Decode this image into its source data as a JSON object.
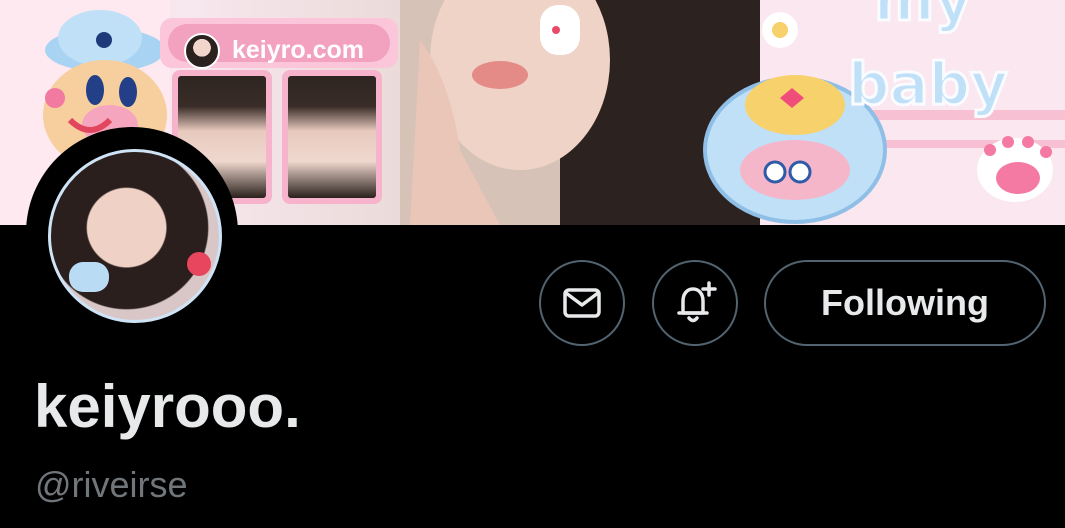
{
  "banner": {
    "site_label": "keiyro.com",
    "sticker_text_top": "my",
    "sticker_text_bottom": "baby"
  },
  "actions": {
    "message": "envelope-icon",
    "notify": "bell-plus-icon",
    "follow_label": "Following"
  },
  "profile": {
    "display_name": "keiyrooo.",
    "handle": "@riveirse"
  },
  "colors": {
    "background": "#000000",
    "button_border": "#536471",
    "primary_text": "#e7e9ea",
    "secondary_text": "#71767b"
  }
}
